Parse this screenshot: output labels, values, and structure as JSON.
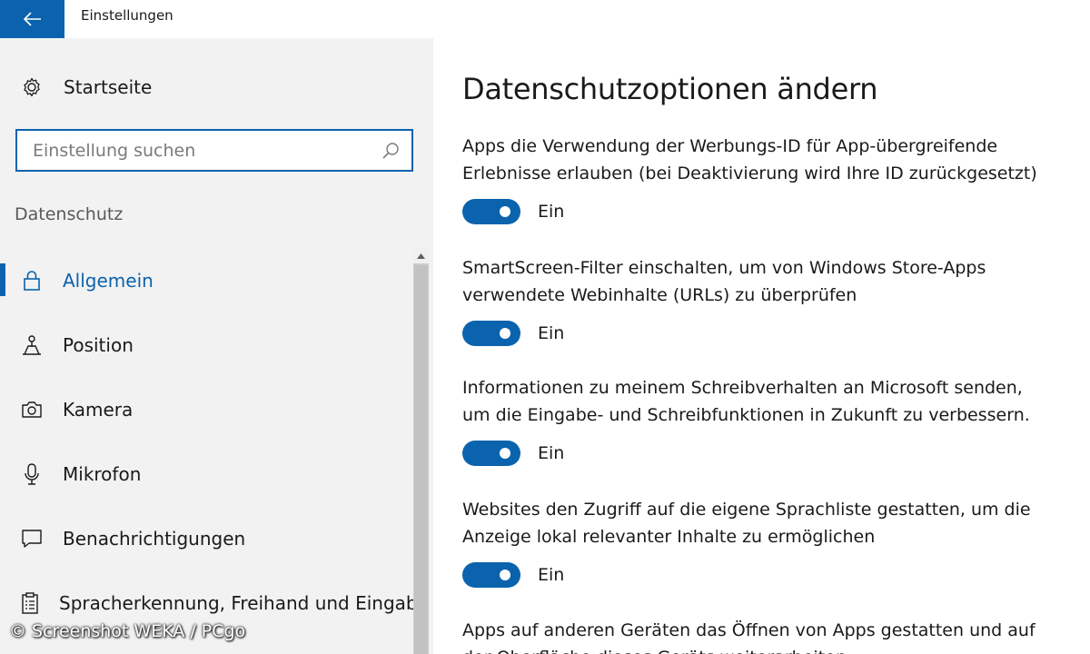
{
  "window": {
    "title": "Einstellungen"
  },
  "sidebar": {
    "home_label": "Startseite",
    "search": {
      "placeholder": "Einstellung suchen"
    },
    "section_title": "Datenschutz",
    "items": [
      {
        "label": "Allgemein",
        "icon": "lock-icon",
        "active": true
      },
      {
        "label": "Position",
        "icon": "location-icon",
        "active": false
      },
      {
        "label": "Kamera",
        "icon": "camera-icon",
        "active": false
      },
      {
        "label": "Mikrofon",
        "icon": "microphone-icon",
        "active": false
      },
      {
        "label": "Benachrichtigungen",
        "icon": "message-icon",
        "active": false
      },
      {
        "label": "Spracherkennung, Freihand und Eingab",
        "icon": "clipboard-icon",
        "active": false
      }
    ]
  },
  "main": {
    "title": "Datenschutzoptionen ändern",
    "options": [
      {
        "line1": "Apps die Verwendung der Werbungs-ID für App-übergreifende",
        "line2": "Erlebnisse erlauben (bei Deaktivierung wird Ihre ID zurückgesetzt)",
        "state": "Ein",
        "on": true
      },
      {
        "line1": "SmartScreen-Filter einschalten, um von Windows Store-Apps",
        "line2": "verwendete Webinhalte (URLs) zu überprüfen",
        "state": "Ein",
        "on": true
      },
      {
        "line1": "Informationen zu meinem Schreibverhalten an Microsoft senden,",
        "line2": "um die Eingabe- und Schreibfunktionen in Zukunft zu verbessern.",
        "state": "Ein",
        "on": true
      },
      {
        "line1": "Websites den Zugriff auf die eigene Sprachliste gestatten, um die",
        "line2": "Anzeige lokal relevanter Inhalte zu ermöglichen",
        "state": "Ein",
        "on": true
      },
      {
        "line1": "Apps auf anderen Geräten das Öffnen von Apps gestatten und auf",
        "line2": "der Oberfläche dieses Geräts weiterarbeiten"
      }
    ]
  },
  "watermark": "© Screenshot WEKA / PCgo",
  "colors": {
    "accent": "#0b63ad",
    "sidebar_bg": "#f2f2f2"
  }
}
